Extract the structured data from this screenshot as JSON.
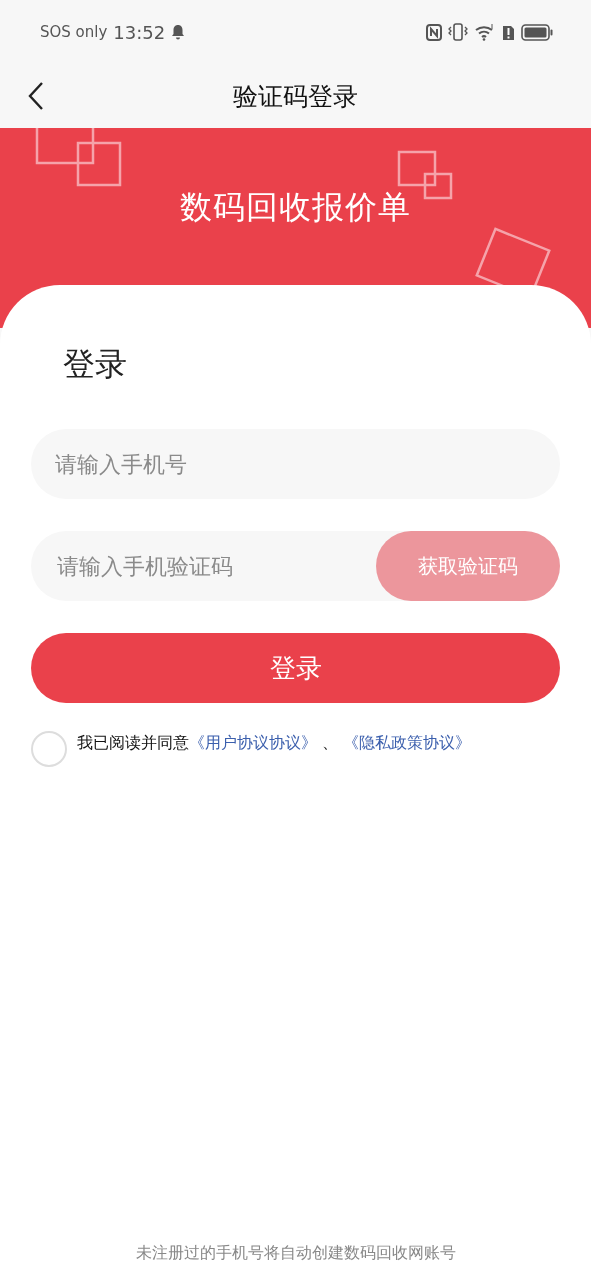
{
  "status_bar": {
    "carrier": "SOS only",
    "time": "13:52"
  },
  "nav": {
    "title": "验证码登录"
  },
  "banner": {
    "title": "数码回收报价单"
  },
  "login": {
    "title": "登录",
    "phone_field": {
      "placeholder": "请输入手机号"
    },
    "code_field": {
      "placeholder": "请输入手机验证码",
      "button": "获取验证码"
    },
    "submit": "登录",
    "agreement": {
      "checked": false,
      "prefix": "我已阅读并同意",
      "links": [
        "《用户协议协议》",
        "《隐私政策协议》"
      ],
      "separator": "、"
    }
  },
  "footer": "未注册过的手机号将自动创建数码回收网账号"
}
